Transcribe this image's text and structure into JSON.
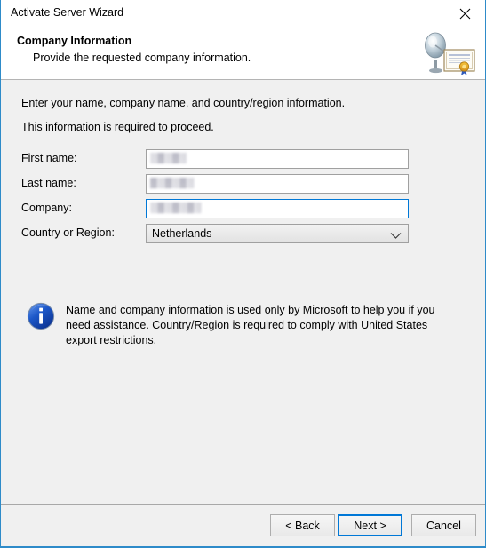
{
  "window": {
    "title": "Activate Server Wizard",
    "close_icon": "close-icon",
    "accent_color": "#2e8bc9"
  },
  "header": {
    "title": "Company Information",
    "subtitle": "Provide the requested company information.",
    "icon": "satellite-dish-certificate-icon"
  },
  "body": {
    "intro_line_1": "Enter your name, company name, and country/region information.",
    "intro_line_2": "This information is required to proceed.",
    "fields": [
      {
        "label": "First name:",
        "value": "░▒░▒░",
        "placeholder": "",
        "focused": false,
        "redacted": true
      },
      {
        "label": "Last name:",
        "value": "▒░▒░▒░",
        "placeholder": "",
        "focused": false,
        "redacted": true
      },
      {
        "label": "Company:",
        "value": "░▒░▒░▒░",
        "placeholder": "",
        "focused": true,
        "redacted": true
      }
    ],
    "country": {
      "label": "Country or Region:",
      "selected": "Netherlands",
      "chevron_icon": "chevron-down-icon"
    },
    "note": {
      "icon": "info-icon",
      "icon_color": "#1c57c8",
      "text": "Name and company information is used only by Microsoft to help you if you need assistance. Country/Region is required to comply with United States export restrictions."
    }
  },
  "footer": {
    "back_label": "< Back",
    "next_label": "Next >",
    "cancel_label": "Cancel",
    "default_button": "Next >",
    "focus_color": "#0078d7"
  }
}
